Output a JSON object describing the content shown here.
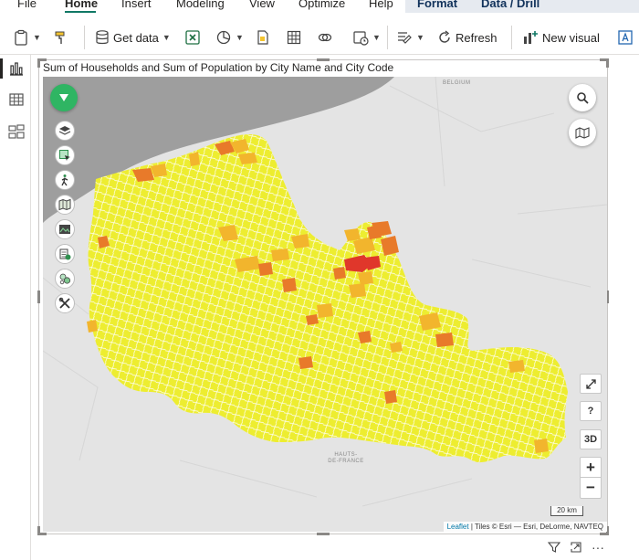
{
  "menu": {
    "tabs": [
      {
        "label": "File"
      },
      {
        "label": "Home"
      },
      {
        "label": "Insert"
      },
      {
        "label": "Modeling"
      },
      {
        "label": "View"
      },
      {
        "label": "Optimize"
      },
      {
        "label": "Help"
      },
      {
        "label": "Format"
      },
      {
        "label": "Data / Drill"
      }
    ]
  },
  "ribbon": {
    "get_data_label": "Get data",
    "refresh_label": "Refresh",
    "new_visual_label": "New visual"
  },
  "visual": {
    "title": "Sum of Households and Sum of Population by City Name and City Code"
  },
  "map": {
    "place_belgium": "BELGIUM",
    "place_region_line1": "HAUTS-",
    "place_region_line2": "DE-FRANCE",
    "scale_label": "20 km",
    "attribution_link": "Leaflet",
    "attribution_text": " | Tiles © Esri — Esri, DeLorme, NAVTEQ",
    "help_label": "?",
    "three_d_label": "3D",
    "zoom_in_label": "+",
    "zoom_out_label": "−",
    "colors": {
      "land_low": "#eded30",
      "mid": "#f2b52d",
      "high": "#e87a2a",
      "max": "#e0372b",
      "sea": "#9e9e9e",
      "background": "#e4e4e4"
    }
  },
  "colors": {
    "accent": "#117865",
    "layers_button": "#2fb563"
  }
}
